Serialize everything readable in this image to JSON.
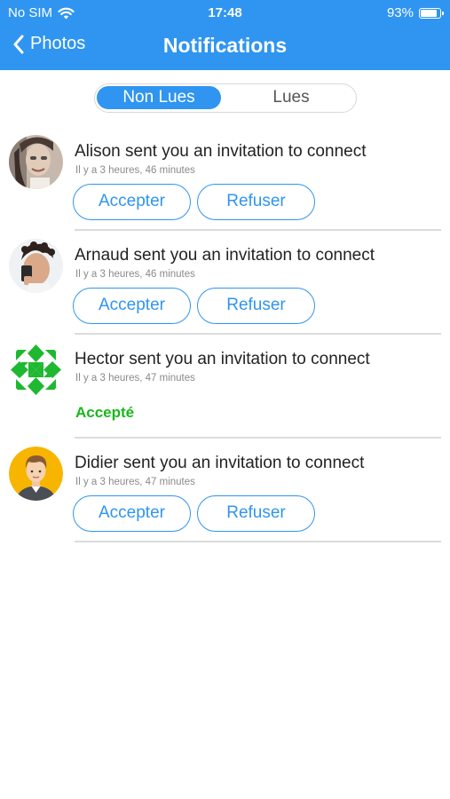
{
  "status_bar": {
    "carrier": "No SIM",
    "time": "17:48",
    "battery_percent": "93%",
    "battery_level": 0.93
  },
  "nav": {
    "back_label": "Photos",
    "title": "Notifications"
  },
  "tabs": {
    "unread": "Non Lues",
    "read": "Lues",
    "selected": "unread"
  },
  "colors": {
    "accent": "#2f95f0",
    "accepted": "#19b81b",
    "divider": "#dcdcdc"
  },
  "notifications": [
    {
      "message": "Alison sent you an invitation to connect",
      "time": "Il y a 3 heures, 46 minutes",
      "accept_label": "Accepter",
      "refuse_label": "Refuser",
      "avatar_icon": "photo-avatar"
    },
    {
      "message": "Arnaud sent you an invitation to connect",
      "time": "Il y a 3 heures, 46 minutes",
      "accept_label": "Accepter",
      "refuse_label": "Refuser",
      "avatar_icon": "photo-avatar"
    },
    {
      "message": "Hector sent you an invitation to connect",
      "time": "Il y a 3 heures, 47 minutes",
      "status": "Accepté",
      "avatar_icon": "identicon-avatar"
    },
    {
      "message": "Didier sent you an invitation to connect",
      "time": "Il y a 3 heures, 47 minutes",
      "accept_label": "Accepter",
      "refuse_label": "Refuser",
      "avatar_icon": "cartoon-avatar"
    }
  ]
}
